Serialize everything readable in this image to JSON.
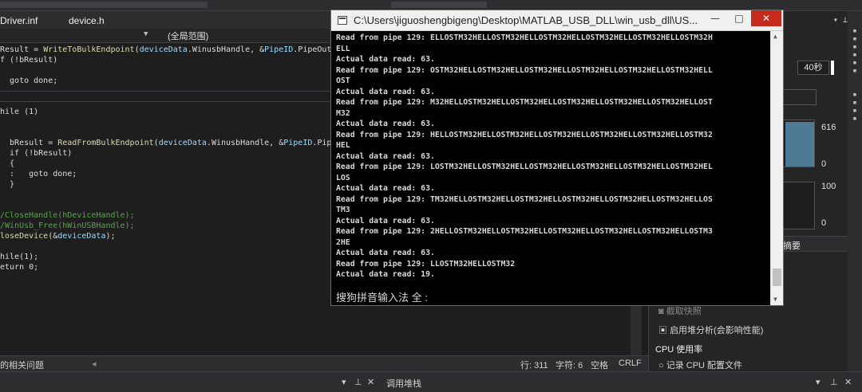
{
  "ide": {
    "tabs": [
      "Driver.inf",
      "device.h"
    ],
    "scope_label": "(全局范围)",
    "code_lines": [
      {
        "segments": [
          [
            "kw",
            "Result = "
          ],
          [
            "fn",
            "WriteToBulkEndpoint"
          ],
          [
            "kw",
            "("
          ],
          [
            "vr",
            "deviceData"
          ],
          [
            "kw",
            ".WinusbHandle, &"
          ],
          [
            "vr",
            "PipeID"
          ],
          [
            "kw",
            ".PipeOutId"
          ]
        ]
      },
      {
        "segments": [
          [
            "kw",
            "f (!bResult)"
          ]
        ]
      },
      {
        "segments": [
          [
            "kw",
            ""
          ]
        ]
      },
      {
        "segments": [
          [
            "kw",
            "  goto done;"
          ]
        ]
      },
      {
        "segments": [
          [
            "kw",
            ""
          ]
        ]
      },
      {
        "segments": [
          [
            "kw",
            ""
          ]
        ]
      },
      {
        "segments": [
          [
            "kw",
            "hile (1)"
          ]
        ]
      },
      {
        "segments": [
          [
            "kw",
            ""
          ]
        ]
      },
      {
        "segments": [
          [
            "kw",
            ""
          ]
        ]
      },
      {
        "segments": [
          [
            "kw",
            "  bResult = "
          ],
          [
            "fn",
            "ReadFromBulkEndpoint"
          ],
          [
            "kw",
            "("
          ],
          [
            "vr",
            "deviceData"
          ],
          [
            "kw",
            ".WinusbHandle, &"
          ],
          [
            "vr",
            "PipeID"
          ],
          [
            "kw",
            ".Pipe"
          ]
        ]
      },
      {
        "segments": [
          [
            "kw",
            "  if (!bResult)"
          ]
        ]
      },
      {
        "segments": [
          [
            "kw",
            "  {"
          ]
        ]
      },
      {
        "segments": [
          [
            "kw",
            "  :   goto done;"
          ]
        ]
      },
      {
        "segments": [
          [
            "kw",
            "  }"
          ]
        ]
      },
      {
        "segments": [
          [
            "kw",
            ""
          ]
        ]
      },
      {
        "segments": [
          [
            "kw",
            ""
          ]
        ]
      },
      {
        "segments": [
          [
            "cm",
            "/CloseHandle(hDeviceHandle);"
          ]
        ]
      },
      {
        "segments": [
          [
            "cm",
            "/WinUsb_Free(hWinUSBHandle);"
          ]
        ]
      },
      {
        "segments": [
          [
            "fn",
            "loseDevice"
          ],
          [
            "kw",
            "(&"
          ],
          [
            "vr",
            "deviceData"
          ],
          [
            "kw",
            ");"
          ]
        ]
      },
      {
        "segments": [
          [
            "kw",
            ""
          ]
        ]
      },
      {
        "segments": [
          [
            "kw",
            "hile(1);"
          ]
        ]
      },
      {
        "segments": [
          [
            "kw",
            "eturn 0;"
          ]
        ]
      }
    ],
    "status": {
      "left": "的相关问题",
      "row": "行: 311",
      "col": "字符: 6",
      "mode": "空格",
      "eol": "CRLF"
    },
    "bottom": {
      "call_stack": "调用堆栈"
    }
  },
  "console": {
    "title": "C:\\Users\\jiguoshengbigeng\\Desktop\\MATLAB_USB_DLL\\win_usb_dll\\US...",
    "lines": [
      "Read from pipe 129: ELLOSTM32HELLOSTM32HELLOSTM32HELLOSTM32HELLOSTM32HELLOSTM32H",
      "ELL",
      "Actual data read: 63.",
      "Read from pipe 129: OSTM32HELLOSTM32HELLOSTM32HELLOSTM32HELLOSTM32HELLOSTM32HELL",
      "OST",
      "Actual data read: 63.",
      "Read from pipe 129: M32HELLOSTM32HELLOSTM32HELLOSTM32HELLOSTM32HELLOSTM32HELLOST",
      "M32",
      "Actual data read: 63.",
      "Read from pipe 129: HELLOSTM32HELLOSTM32HELLOSTM32HELLOSTM32HELLOSTM32HELLOSTM32",
      "HEL",
      "Actual data read: 63.",
      "Read from pipe 129: LOSTM32HELLOSTM32HELLOSTM32HELLOSTM32HELLOSTM32HELLOSTM32HEL",
      "LOS",
      "Actual data read: 63.",
      "Read from pipe 129: TM32HELLOSTM32HELLOSTM32HELLOSTM32HELLOSTM32HELLOSTM32HELLOS",
      "TM3",
      "Actual data read: 63.",
      "Read from pipe 129: 2HELLOSTM32HELLOSTM32HELLOSTM32HELLOSTM32HELLOSTM32HELLOSTM3",
      "2HE",
      "Actual data read: 63.",
      "Read from pipe 129: LLOSTM32HELLOSTM32",
      "Actual data read: 19."
    ],
    "ime": "搜狗拼音输入法 全 :"
  },
  "diagnostics": {
    "time_value": "40秒",
    "chart_top": "616",
    "chart_top_min": "0",
    "chart_mid": "100",
    "chart_mid_min": "0",
    "section_label": "摘要",
    "items": [
      {
        "icon": "camera-icon",
        "label": "截取快照"
      },
      {
        "icon": "heap-icon",
        "label": "启用堆分析(会影响性能)"
      }
    ],
    "cpu_header": "CPU 使用率",
    "cpu_item": "记录 CPU 配置文件",
    "colors": {
      "chart_fill": "#4e7a96"
    }
  }
}
